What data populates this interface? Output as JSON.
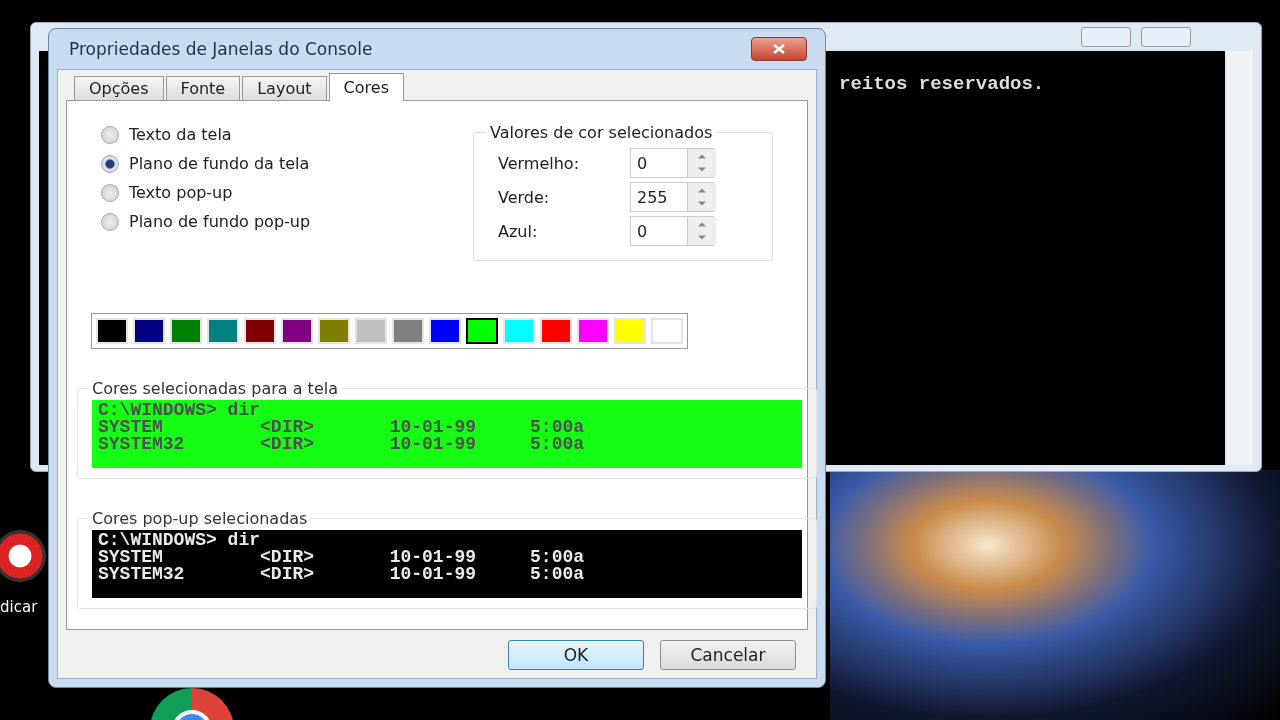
{
  "console_window": {
    "text": "reitos reservados."
  },
  "desktop": {
    "icon_label": "dicar"
  },
  "dialog": {
    "title": "Propriedades de Janelas do Console",
    "tabs": [
      {
        "label": "Opções",
        "selected": false
      },
      {
        "label": "Fonte",
        "selected": false
      },
      {
        "label": "Layout",
        "selected": false
      },
      {
        "label": "Cores",
        "selected": true
      }
    ],
    "targets": [
      {
        "label": "Texto da tela",
        "selected": false
      },
      {
        "label": "Plano de fundo da tela",
        "selected": true
      },
      {
        "label": "Texto pop-up",
        "selected": false
      },
      {
        "label": "Plano de fundo pop-up",
        "selected": false
      }
    ],
    "color_values": {
      "title": "Valores de cor selecionados",
      "fields": [
        {
          "label": "Vermelho:",
          "value": "0"
        },
        {
          "label": "Verde:",
          "value": "255"
        },
        {
          "label": "Azul:",
          "value": "0"
        }
      ]
    },
    "palette": [
      {
        "color": "#000000",
        "selected": false
      },
      {
        "color": "#000080",
        "selected": false
      },
      {
        "color": "#008000",
        "selected": false
      },
      {
        "color": "#008080",
        "selected": false
      },
      {
        "color": "#800000",
        "selected": false
      },
      {
        "color": "#800080",
        "selected": false
      },
      {
        "color": "#808000",
        "selected": false
      },
      {
        "color": "#c0c0c0",
        "selected": false
      },
      {
        "color": "#808080",
        "selected": false
      },
      {
        "color": "#0000ff",
        "selected": false
      },
      {
        "color": "#00ff00",
        "selected": true
      },
      {
        "color": "#00ffff",
        "selected": false
      },
      {
        "color": "#ff0000",
        "selected": false
      },
      {
        "color": "#ff00ff",
        "selected": false
      },
      {
        "color": "#ffff00",
        "selected": false
      },
      {
        "color": "#ffffff",
        "selected": false
      }
    ],
    "previews": [
      {
        "title": "Cores selecionadas para a tela",
        "color": "#14ff14",
        "lines": [
          "C:\\WINDOWS> dir",
          "SYSTEM         <DIR>       10-01-99     5:00a",
          "SYSTEM32       <DIR>       10-01-99     5:00a"
        ]
      },
      {
        "title": "Cores pop-up selecionadas",
        "color": "#000000",
        "lines": [
          "C:\\WINDOWS> dir",
          "SYSTEM         <DIR>       10-01-99     5:00a",
          "SYSTEM32       <DIR>       10-01-99     5:00a"
        ]
      }
    ],
    "buttons": [
      {
        "label": "OK",
        "selected": true
      },
      {
        "label": "Cancelar",
        "selected": false
      }
    ]
  }
}
